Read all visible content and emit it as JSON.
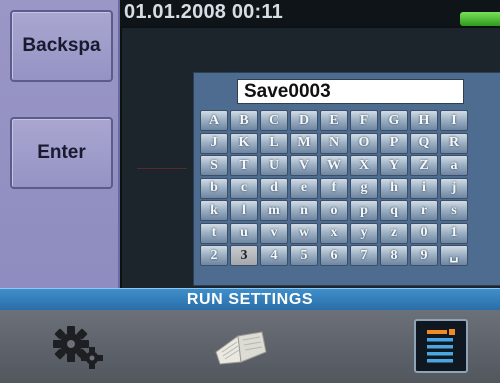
{
  "sidebar": {
    "backspace_label": "Backspa",
    "enter_label": "Enter"
  },
  "header": {
    "datetime": "01.01.2008  00:11"
  },
  "keyboard": {
    "input_value": "Save0003",
    "rows": [
      [
        "A",
        "B",
        "C",
        "D",
        "E",
        "F",
        "G",
        "H",
        "I"
      ],
      [
        "J",
        "K",
        "L",
        "M",
        "N",
        "O",
        "P",
        "Q",
        "R"
      ],
      [
        "S",
        "T",
        "U",
        "V",
        "W",
        "X",
        "Y",
        "Z",
        "a"
      ],
      [
        "b",
        "c",
        "d",
        "e",
        "f",
        "g",
        "h",
        "i",
        "j"
      ],
      [
        "k",
        "l",
        "m",
        "n",
        "o",
        "p",
        "q",
        "r",
        "s"
      ],
      [
        "t",
        "u",
        "v",
        "w",
        "x",
        "y",
        "z",
        "0",
        "1"
      ],
      [
        "2",
        "3",
        "4",
        "5",
        "6",
        "7",
        "8",
        "9",
        "␣"
      ]
    ],
    "selected_key": "3"
  },
  "title_bar": {
    "text": "RUN SETTINGS"
  },
  "toolbar": {
    "items": [
      {
        "icon": "gears-icon"
      },
      {
        "icon": "open-book-icon"
      },
      {
        "icon": "list-icon"
      }
    ]
  },
  "colors": {
    "side_panel": "#9a97c6",
    "keyboard_bg": "#4e6c90",
    "title_bar": "#2f7cb9",
    "battery": "#4cc02f",
    "list_accent": "#f08a25"
  }
}
